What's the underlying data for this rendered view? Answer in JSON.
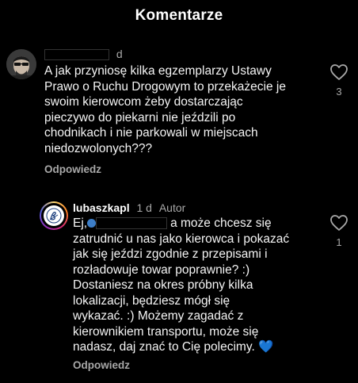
{
  "header": {
    "title": "Komentarze"
  },
  "comments": [
    {
      "username": "",
      "time": "d",
      "lines": [
        "A jak przyniosę kilka egzemplarzy Ustawy",
        "Prawo o Ruchu Drogowym to przekażecie je",
        "swoim kierowcom żeby dostarczając",
        "pieczywo do piekarni nie jeździli po",
        "chodnikach i nie parkowali w miejscach",
        "niedozwolonych???"
      ],
      "reply_label": "Odpowiedz",
      "likes": "3"
    },
    {
      "username": "lubaszkapl",
      "time": "1 d",
      "author_label": "Autor",
      "mention_prefix": "Ej,",
      "lines": [
        "a może chcesz się",
        "zatrudnić u nas jako kierowca i pokazać",
        "jak się jeździ zgodnie z przepisami i",
        "rozładowuje towar poprawnie? :)",
        "Dostaniesz na okres próbny kilka",
        "lokalizacji, będziesz mógł się",
        "wykazać. :) Możemy zagadać z",
        "kierownikiem transportu, może się",
        "nadasz, daj znać to Cię polecimy. 💙"
      ],
      "reply_label": "Odpowiedz",
      "likes": "1"
    }
  ],
  "colors": {
    "background": "#000000",
    "text": "#f5f5f5",
    "muted": "#a8a8a8"
  },
  "icons": [
    "heart-outline-icon",
    "avatar-sunglasses",
    "lubaszka-logo-avatar"
  ]
}
